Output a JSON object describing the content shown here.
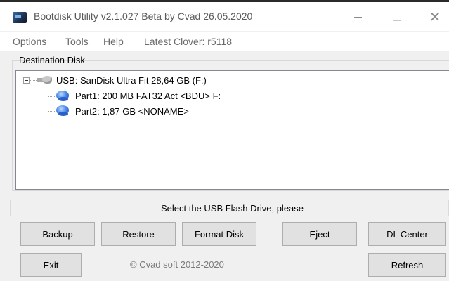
{
  "window": {
    "title": "Bootdisk Utility v2.1.027 Beta by Cvad 26.05.2020",
    "close_glyph": "✕"
  },
  "menu": {
    "options": "Options",
    "tools": "Tools",
    "help": "Help",
    "latest_clover": "Latest Clover: r5118"
  },
  "destination": {
    "label": "Destination Disk",
    "tree": {
      "usb": "USB: SanDisk Ultra Fit 28,64 GB (F:)",
      "part1": "Part1: 200 MB FAT32 Act <BDU> F:",
      "part2": "Part2: 1,87 GB <NONAME>"
    },
    "icons": {
      "usb": "usb-drive-icon",
      "partition": "partition-disk-icon"
    }
  },
  "status": "Select the USB Flash Drive, please",
  "buttons": {
    "backup": "Backup",
    "restore": "Restore",
    "format": "Format Disk",
    "eject": "Eject",
    "dl_center": "DL Center",
    "exit": "Exit",
    "refresh": "Refresh"
  },
  "copyright": "© Cvad soft 2012-2020"
}
